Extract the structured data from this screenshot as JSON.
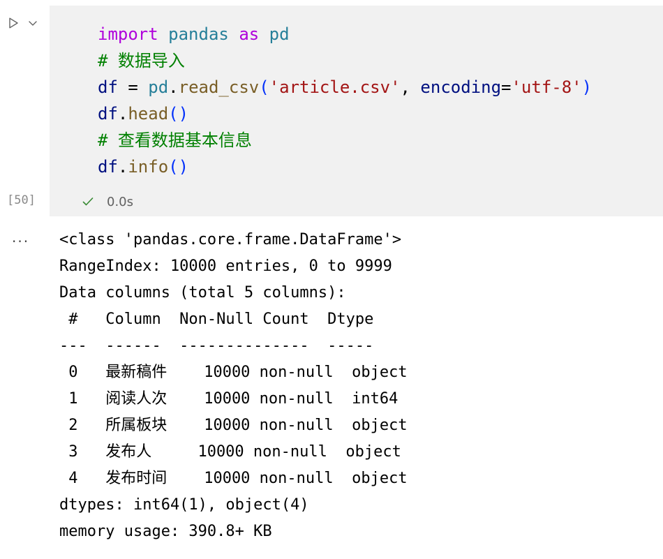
{
  "cell": {
    "execution_count": "[50]",
    "run_button_label": "run-cell",
    "chevron_label": "more-actions",
    "status": {
      "icon": "check-icon",
      "elapsed": "0.0s"
    },
    "code_lines": [
      {
        "id": "line-1",
        "tokens": [
          {
            "t": "import",
            "c": "tok-kw"
          },
          {
            "t": " ",
            "c": "tok-punct"
          },
          {
            "t": "pandas",
            "c": "tok-mod"
          },
          {
            "t": " ",
            "c": "tok-punct"
          },
          {
            "t": "as",
            "c": "tok-kw"
          },
          {
            "t": " ",
            "c": "tok-punct"
          },
          {
            "t": "pd",
            "c": "tok-mod"
          }
        ]
      },
      {
        "id": "line-2",
        "tokens": [
          {
            "t": "# 数据导入",
            "c": "tok-comment"
          }
        ]
      },
      {
        "id": "line-3",
        "tokens": [
          {
            "t": "df",
            "c": "tok-var"
          },
          {
            "t": " ",
            "c": "tok-punct"
          },
          {
            "t": "=",
            "c": "tok-op"
          },
          {
            "t": " ",
            "c": "tok-punct"
          },
          {
            "t": "pd",
            "c": "tok-mod"
          },
          {
            "t": ".",
            "c": "tok-punct"
          },
          {
            "t": "read_csv",
            "c": "tok-fn"
          },
          {
            "t": "(",
            "c": "tok-brk"
          },
          {
            "t": "'article.csv'",
            "c": "tok-str"
          },
          {
            "t": ",",
            "c": "tok-punct"
          },
          {
            "t": " ",
            "c": "tok-punct"
          },
          {
            "t": "encoding",
            "c": "tok-var"
          },
          {
            "t": "=",
            "c": "tok-op"
          },
          {
            "t": "'utf-8'",
            "c": "tok-str"
          },
          {
            "t": ")",
            "c": "tok-brk"
          }
        ]
      },
      {
        "id": "line-4",
        "tokens": [
          {
            "t": "df",
            "c": "tok-var"
          },
          {
            "t": ".",
            "c": "tok-punct"
          },
          {
            "t": "head",
            "c": "tok-fn"
          },
          {
            "t": "(",
            "c": "tok-brk"
          },
          {
            "t": ")",
            "c": "tok-brk"
          }
        ]
      },
      {
        "id": "line-5",
        "tokens": [
          {
            "t": "# 查看数据基本信息",
            "c": "tok-comment"
          }
        ]
      },
      {
        "id": "line-6",
        "tokens": [
          {
            "t": "df",
            "c": "tok-var"
          },
          {
            "t": ".",
            "c": "tok-punct"
          },
          {
            "t": "info",
            "c": "tok-fn"
          },
          {
            "t": "(",
            "c": "tok-brk"
          },
          {
            "t": ")",
            "c": "tok-brk"
          }
        ]
      }
    ]
  },
  "output": {
    "prefix": "···",
    "lines": [
      "<class 'pandas.core.frame.DataFrame'>",
      "RangeIndex: 10000 entries, 0 to 9999",
      "Data columns (total 5 columns):",
      " #   Column  Non-Null Count  Dtype ",
      "---  ------  --------------  ----- ",
      " 0   最新稿件    10000 non-null  object",
      " 1   阅读人次    10000 non-null  int64 ",
      " 2   所属板块    10000 non-null  object",
      " 3   发布人     10000 non-null  object",
      " 4   发布时间    10000 non-null  object",
      "dtypes: int64(1), object(4)",
      "memory usage: 390.8+ KB"
    ],
    "table": {
      "headers": [
        "#",
        "Column",
        "Non-Null Count",
        "Dtype"
      ],
      "rows": [
        [
          "0",
          "最新稿件",
          "10000 non-null",
          "object"
        ],
        [
          "1",
          "阅读人次",
          "10000 non-null",
          "int64"
        ],
        [
          "2",
          "所属板块",
          "10000 non-null",
          "object"
        ],
        [
          "3",
          "发布人",
          "10000 non-null",
          "object"
        ],
        [
          "4",
          "发布时间",
          "10000 non-null",
          "object"
        ]
      ]
    },
    "class_name": "<class 'pandas.core.frame.DataFrame'>",
    "range_index": "RangeIndex: 10000 entries, 0 to 9999",
    "columns_summary": "Data columns (total 5 columns):",
    "dtypes_line": "dtypes: int64(1), object(4)",
    "memory_line": "memory usage: 390.8+ KB"
  },
  "colors": {
    "cell_background": "#f1f1f1",
    "page_background": "#ffffff",
    "keyword": "#AF00DB",
    "module": "#267F99",
    "variable": "#001080",
    "function": "#795E26",
    "string": "#A31515",
    "bracket": "#0431FA",
    "comment": "#008000",
    "success": "#388A34",
    "muted_text": "#616161"
  }
}
